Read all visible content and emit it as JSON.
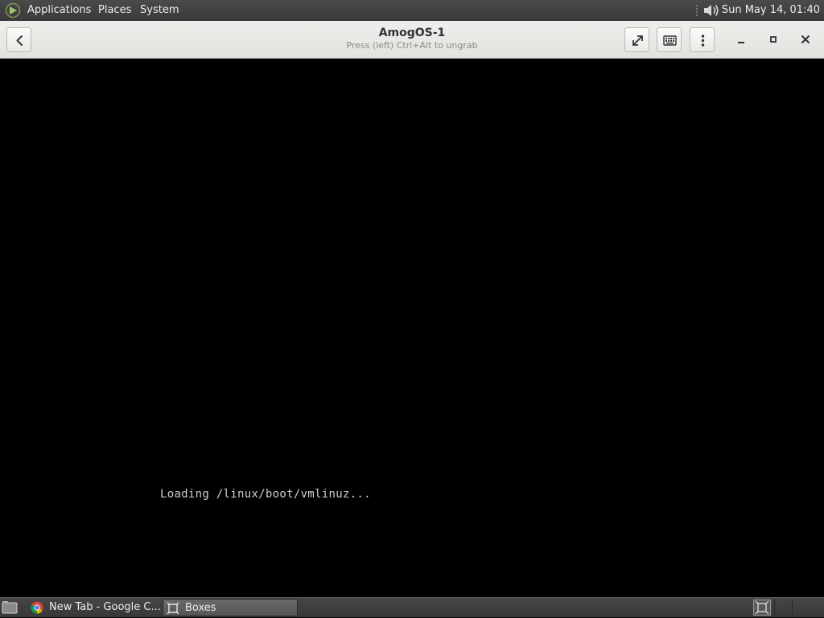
{
  "top_panel": {
    "menus": [
      "Applications",
      "Places",
      "System"
    ],
    "clock": "Sun May 14, 01:40",
    "icons": {
      "logo": "distro-logo-icon",
      "volume": "volume-icon"
    }
  },
  "window": {
    "title": "AmogOS-1",
    "subtitle": "Press (left) Ctrl+Alt to ungrab",
    "icons": {
      "back": "chevron-left-icon",
      "fullscreen": "fullscreen-icon",
      "keyboard": "keyboard-icon",
      "menu": "vertical-dots-icon",
      "minimize": "minimize-icon",
      "maximize": "maximize-icon",
      "close": "close-icon"
    }
  },
  "vm_console": {
    "lines": [
      "Loading /linux/boot/vmlinuz..."
    ]
  },
  "taskbar": {
    "tasks": [
      {
        "label": "New Tab - Google C...",
        "icon": "chrome-icon",
        "active": false
      },
      {
        "label": "Boxes",
        "icon": "boxes-icon",
        "active": true
      }
    ]
  },
  "colors": {
    "panel": "#3c3c3c",
    "headerbar": "#e8e6e3",
    "vm_background": "#000000",
    "console_text": "#cfcfcf"
  }
}
